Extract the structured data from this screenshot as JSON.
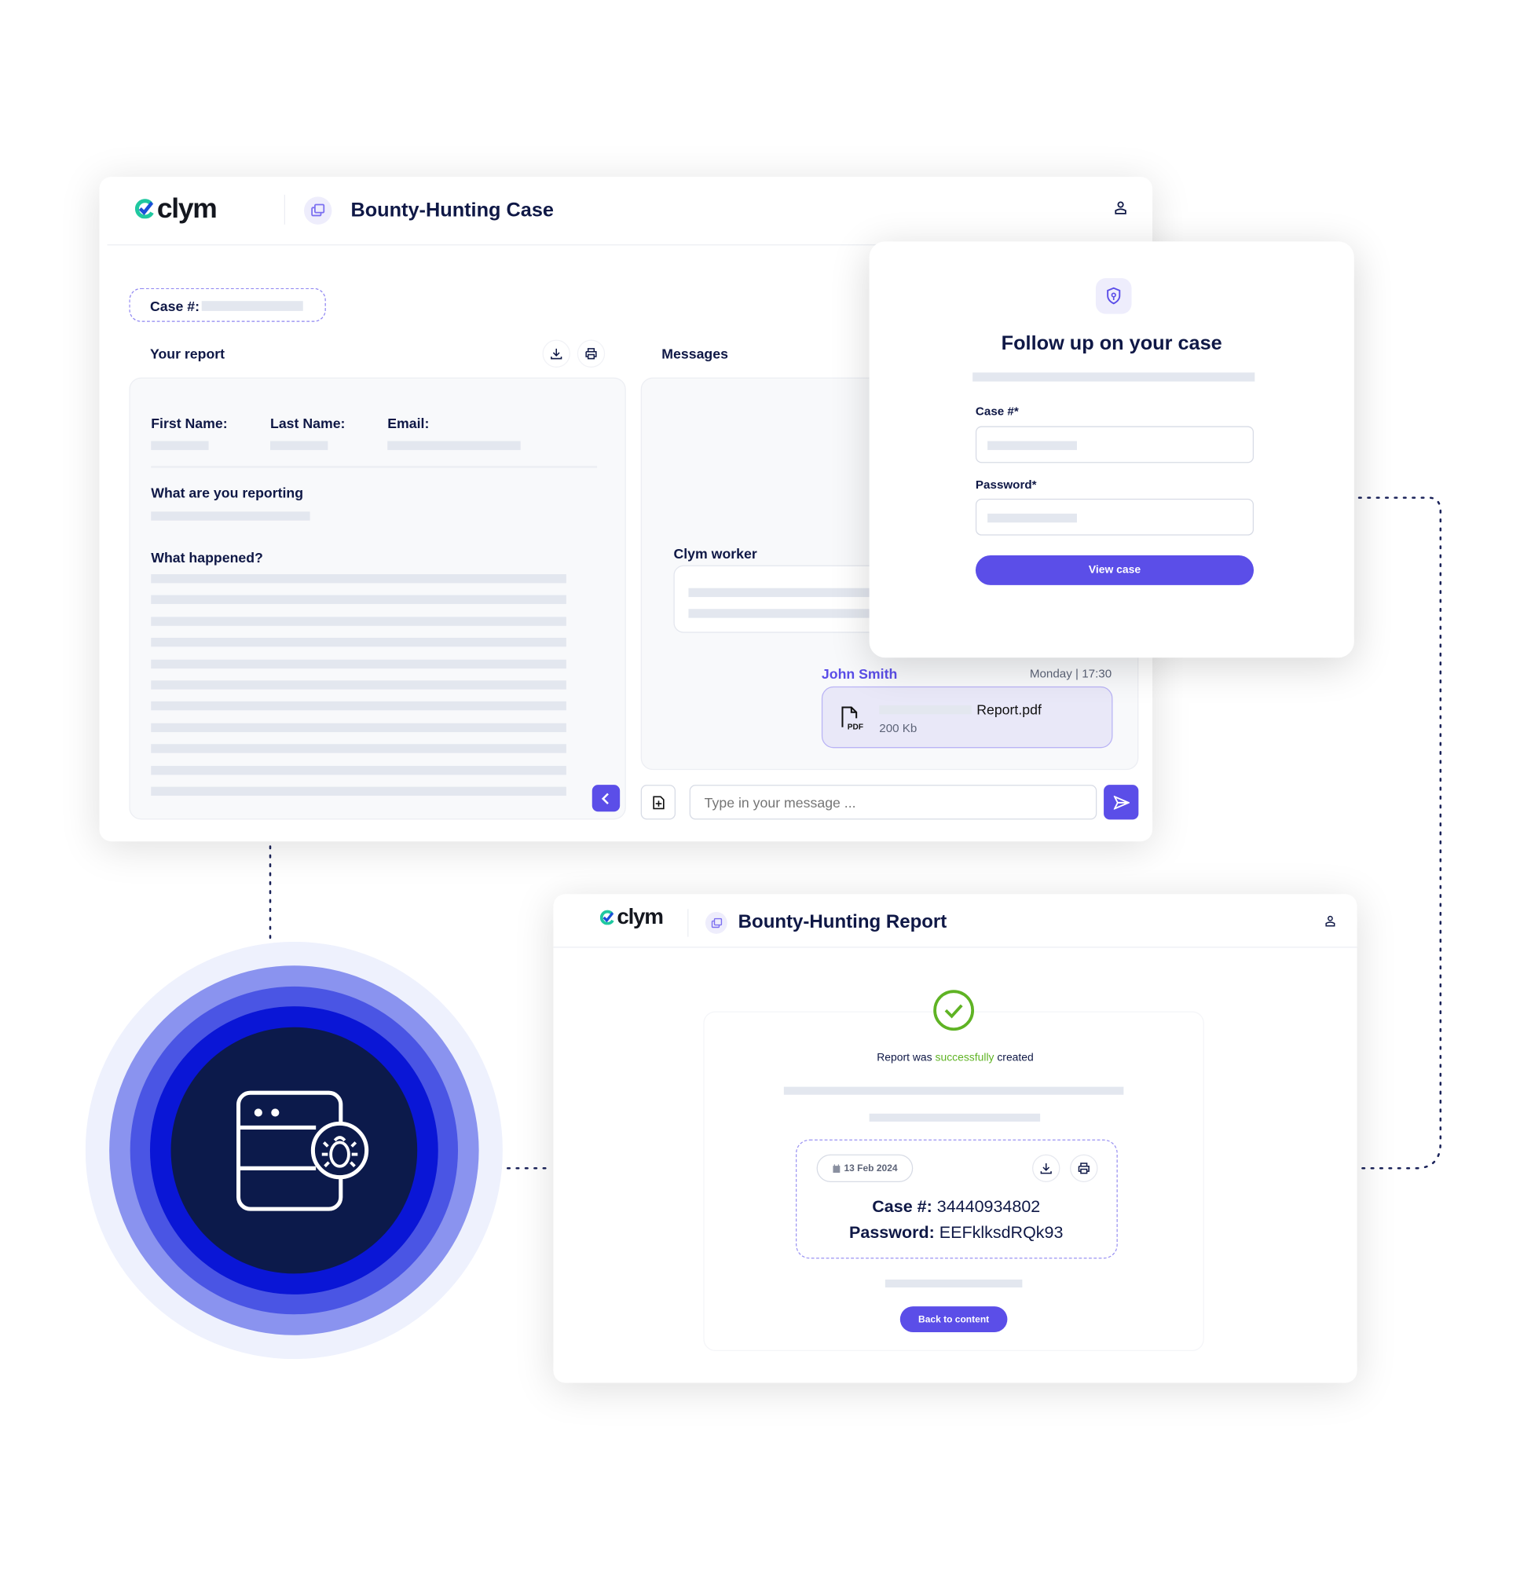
{
  "colors": {
    "accent": "#5b4ee8",
    "navy": "#0f1846",
    "success": "#5fb324",
    "placeholder": "#e3e7ef"
  },
  "brand": {
    "logo_text": "clym"
  },
  "case_window": {
    "title": "Bounty-Hunting Case",
    "case_label": "Case #:",
    "your_report": "Your report",
    "messages": "Messages",
    "fields": {
      "first_name": "First Name:",
      "last_name": "Last Name:",
      "email": "Email:"
    },
    "what_reporting": "What are you reporting",
    "what_happened": "What happened?",
    "worker_label": "Clym worker",
    "message": {
      "sender": "John Smith",
      "time": "Monday | 17:30",
      "file_name": "Report.pdf",
      "file_size": "200 Kb",
      "file_icon_text": "PDF"
    },
    "input_placeholder": "Type in your message ..."
  },
  "follow_up": {
    "title": "Follow up on your case",
    "case_label": "Case #*",
    "password_label": "Password*",
    "button": "View case"
  },
  "report_window": {
    "title": "Bounty-Hunting Report",
    "success_prefix": "Report was ",
    "success_word": "successfully",
    "success_suffix": " created",
    "date": "13 Feb 2024",
    "case_label": "Case #:",
    "case_value": " 34440934802",
    "password_label": "Password:",
    "password_value": " EEFklksdRQk93",
    "button": "Back to content"
  },
  "icons": [
    "clym-logo-icon",
    "case-icon",
    "user-icon",
    "download-icon",
    "print-icon",
    "chevron-left-icon",
    "attach-file-icon",
    "send-icon",
    "pdf-file-icon",
    "shield-icon",
    "check-circle-icon",
    "calendar-icon",
    "bug-server-icon"
  ]
}
